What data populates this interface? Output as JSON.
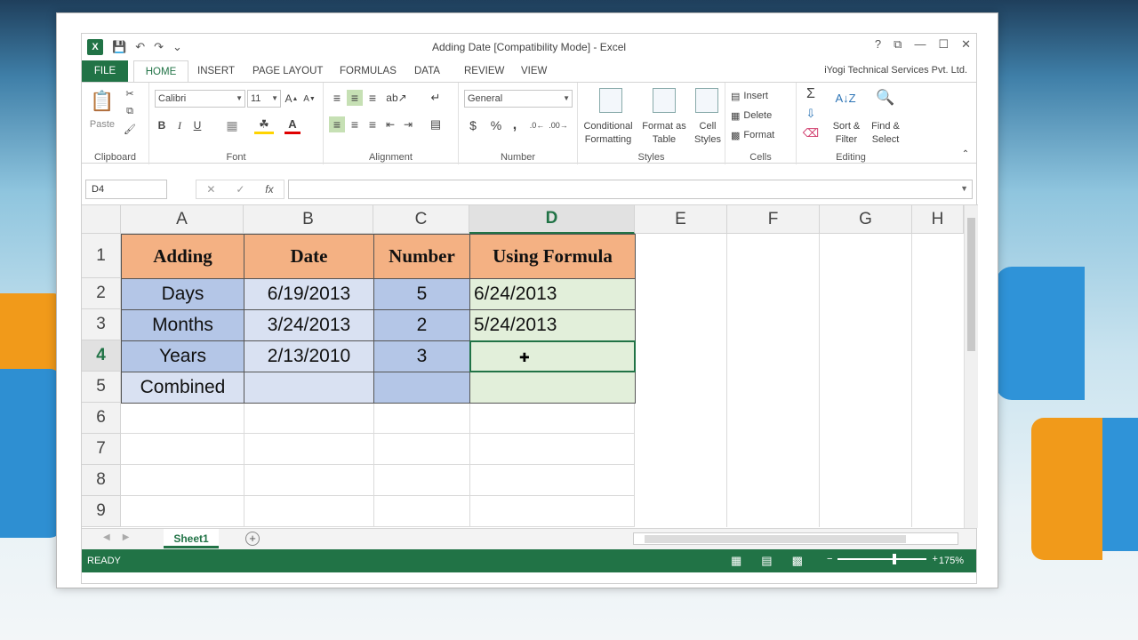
{
  "window": {
    "title": "Adding Date  [Compatibility Mode] - Excel",
    "app_icon": "X",
    "controls": [
      "?",
      "⧉",
      "—",
      "☐",
      "✕"
    ]
  },
  "tabs": [
    "FILE",
    "HOME",
    "INSERT",
    "PAGE LAYOUT",
    "FORMULAS",
    "DATA",
    "REVIEW",
    "VIEW"
  ],
  "account": "iYogi Technical Services Pvt. Ltd.",
  "ribbon": {
    "clipboard": {
      "paste": "Paste",
      "label": "Clipboard"
    },
    "font": {
      "name": "Calibri",
      "size": "11",
      "bold": "B",
      "italic": "I",
      "underline": "U",
      "label": "Font"
    },
    "alignment": {
      "label": "Alignment"
    },
    "number": {
      "format": "General",
      "currency": "$",
      "percent": "%",
      "comma": ",",
      "label": "Number"
    },
    "styles": {
      "conditional": "Conditional\nFormatting",
      "format_table": "Format as\nTable",
      "cell_styles": "Cell\nStyles",
      "label": "Styles"
    },
    "cells": {
      "insert": "Insert",
      "delete": "Delete",
      "format": "Format",
      "label": "Cells"
    },
    "editing": {
      "sort": "Sort &\nFilter",
      "find": "Find &\nSelect",
      "label": "Editing"
    }
  },
  "formula_bar": {
    "name_box": "D4",
    "fx": "fx",
    "value": ""
  },
  "columns": [
    "A",
    "B",
    "C",
    "D",
    "E",
    "F",
    "G",
    "H"
  ],
  "rows": [
    "1",
    "2",
    "3",
    "4",
    "5",
    "6",
    "7",
    "8",
    "9"
  ],
  "table": {
    "headers": [
      "Adding",
      "Date",
      "Number",
      "Using Formula"
    ],
    "rows": [
      [
        "Days",
        "6/19/2013",
        "5",
        "6/24/2013"
      ],
      [
        "Months",
        "3/24/2013",
        "2",
        "5/24/2013"
      ],
      [
        "Years",
        "2/13/2010",
        "3",
        ""
      ],
      [
        "Combined",
        "",
        "",
        ""
      ]
    ]
  },
  "selected_cell": "D4",
  "sheet": {
    "name": "Sheet1",
    "add": "+"
  },
  "status": {
    "text": "READY",
    "zoom": "175%"
  },
  "colors": {
    "excel_green": "#217346",
    "header_orange": "#f4b183",
    "blue": "#b4c6e7",
    "green": "#e2efda"
  }
}
